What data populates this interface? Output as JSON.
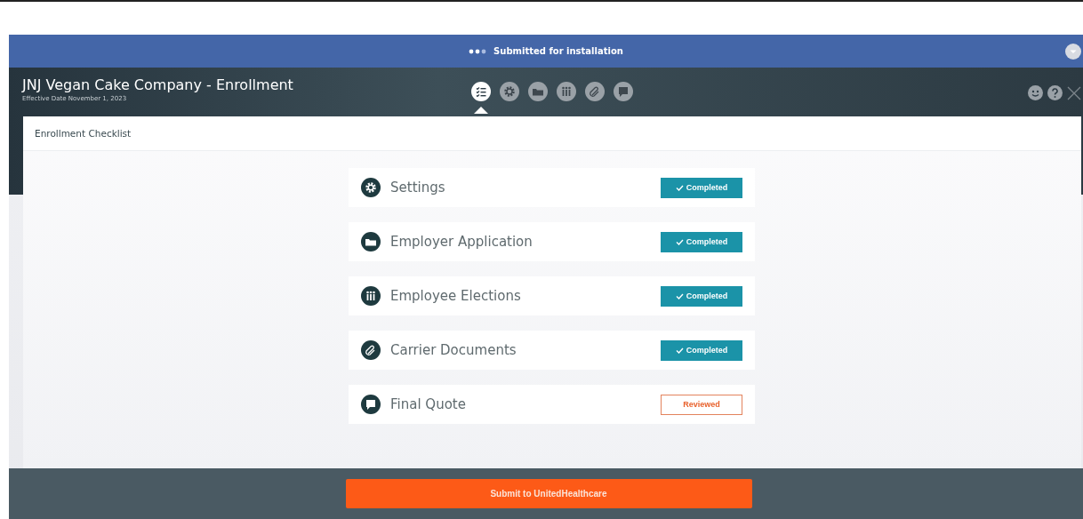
{
  "status_banner": {
    "text": "Submitted for installation"
  },
  "header": {
    "title": "JNJ Vegan Cake Company - Enrollment",
    "subtitle": "Effective Date November 1, 2023"
  },
  "nav_icons": [
    {
      "kind": "checklist",
      "selected": true
    },
    {
      "kind": "gear",
      "selected": false
    },
    {
      "kind": "folder",
      "selected": false
    },
    {
      "kind": "people",
      "selected": false
    },
    {
      "kind": "paperclip",
      "selected": false
    },
    {
      "kind": "quote",
      "selected": false
    }
  ],
  "panel": {
    "title": "Enrollment Checklist"
  },
  "checklist": [
    {
      "kind": "gear",
      "label": "Settings",
      "completed": true,
      "status_text": "Completed"
    },
    {
      "kind": "folder",
      "label": "Employer Application",
      "completed": true,
      "status_text": "Completed"
    },
    {
      "kind": "people",
      "label": "Employee Elections",
      "completed": true,
      "status_text": "Completed"
    },
    {
      "kind": "paperclip",
      "label": "Carrier Documents",
      "completed": true,
      "status_text": "Completed"
    },
    {
      "kind": "quote",
      "label": "Final Quote",
      "completed": false,
      "status_text": "Reviewed"
    }
  ],
  "submit_button": {
    "label": "Submit to UnitedHealthcare"
  }
}
